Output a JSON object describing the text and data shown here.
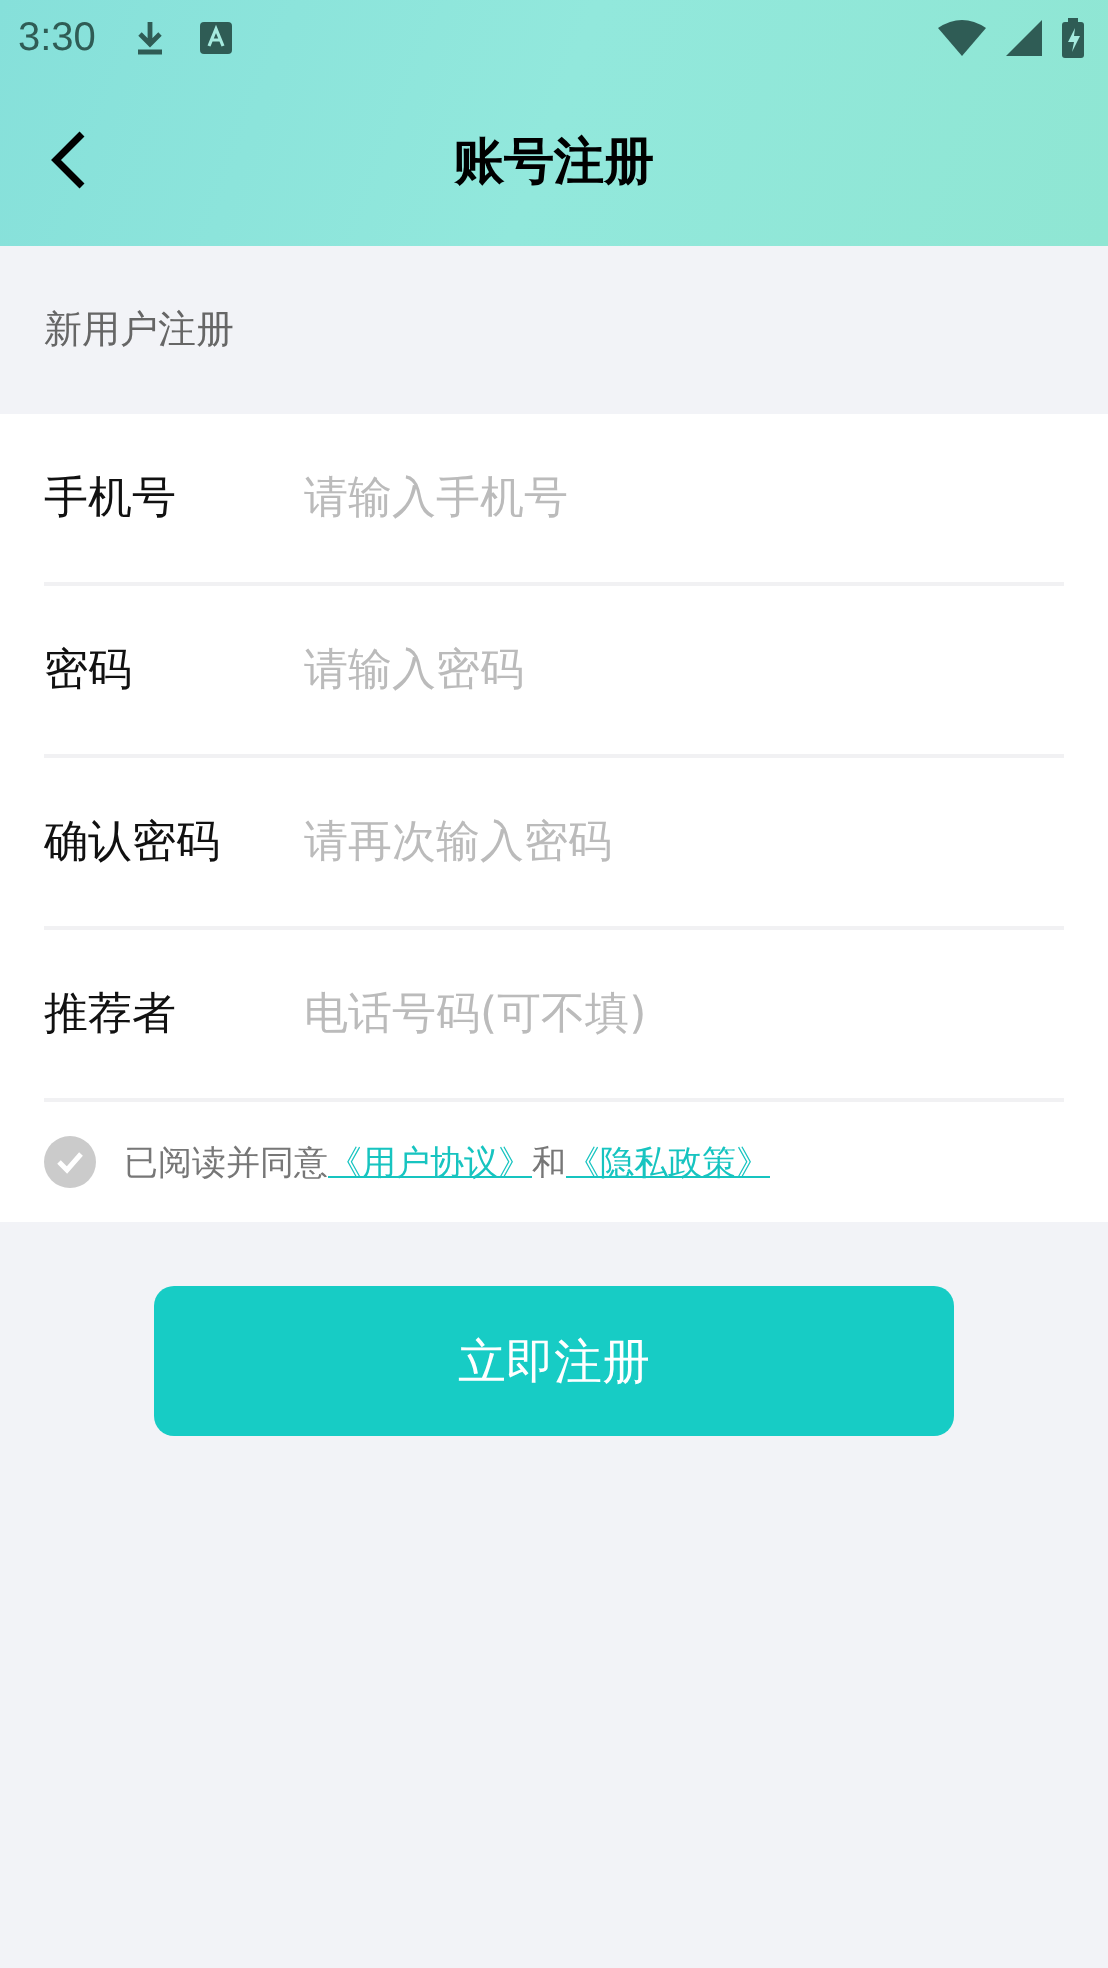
{
  "status_bar": {
    "time": "3:30"
  },
  "nav": {
    "title": "账号注册"
  },
  "section_label": "新用户注册",
  "fields": [
    {
      "label": "手机号",
      "placeholder": "请输入手机号"
    },
    {
      "label": "密码",
      "placeholder": "请输入密码"
    },
    {
      "label": "确认密码",
      "placeholder": "请再次输入密码"
    },
    {
      "label": "推荐者",
      "placeholder": "电话号码(可不填)"
    }
  ],
  "agreement": {
    "checked": false,
    "prefix": "已阅读并同意",
    "link_1": "《用户协议》",
    "joiner": "和",
    "link_2": "《隐私政策》"
  },
  "submit_button": "立即注册"
}
